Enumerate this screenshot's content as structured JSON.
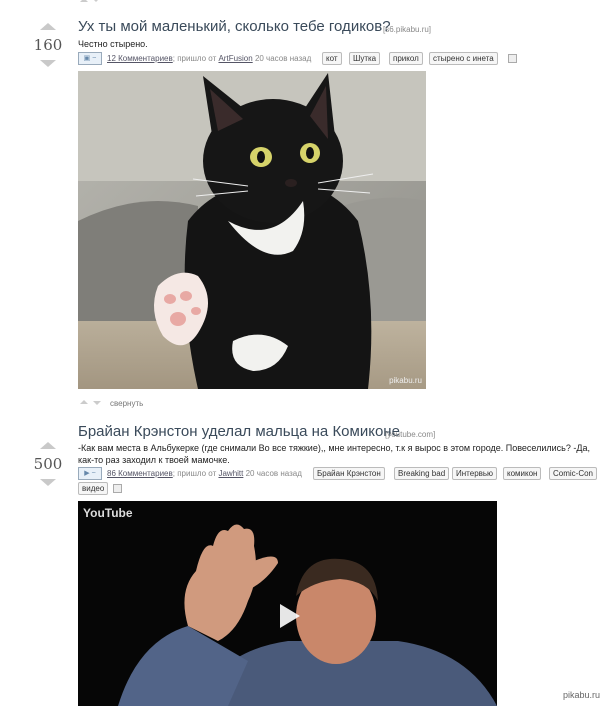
{
  "post1": {
    "score": "160",
    "title": "Ух ты мой маленький, сколько тебе годиков?",
    "domain": "[s6.pikabu.ru]",
    "description": "Честно стырено.",
    "comments_link": "12 Комментариев",
    "meta_text": "; пришло от",
    "author": "ArtFusion",
    "time": "20 часов назад",
    "tags": [
      "кот",
      "Шутка",
      "прикол",
      "стырено с инета"
    ],
    "image_watermark": "pikabu.ru",
    "collapse_label": "свернуть"
  },
  "post2": {
    "score": "500",
    "title": "Брайан Крэнстон уделал мальца на Комиконе",
    "domain": "[youtube.com]",
    "description": "-Как вам места в Альбукерке (где снимали Во все тяжкие),, мне интересно, т.к я вырос в этом городе. Повеселились? -Да, как-то раз заходил к твоей мамочке.",
    "comments_link": "86 Комментариев",
    "meta_text": "; пришло от",
    "author": "Jawhitt",
    "time": "20 часов назад",
    "tags": [
      "Брайан Крэнстон",
      "Breaking bad",
      "Интервью",
      "комикон",
      "Comic-Con",
      "видео"
    ],
    "video_logo": "YouTube"
  },
  "footer_watermark": "pikabu.ru"
}
